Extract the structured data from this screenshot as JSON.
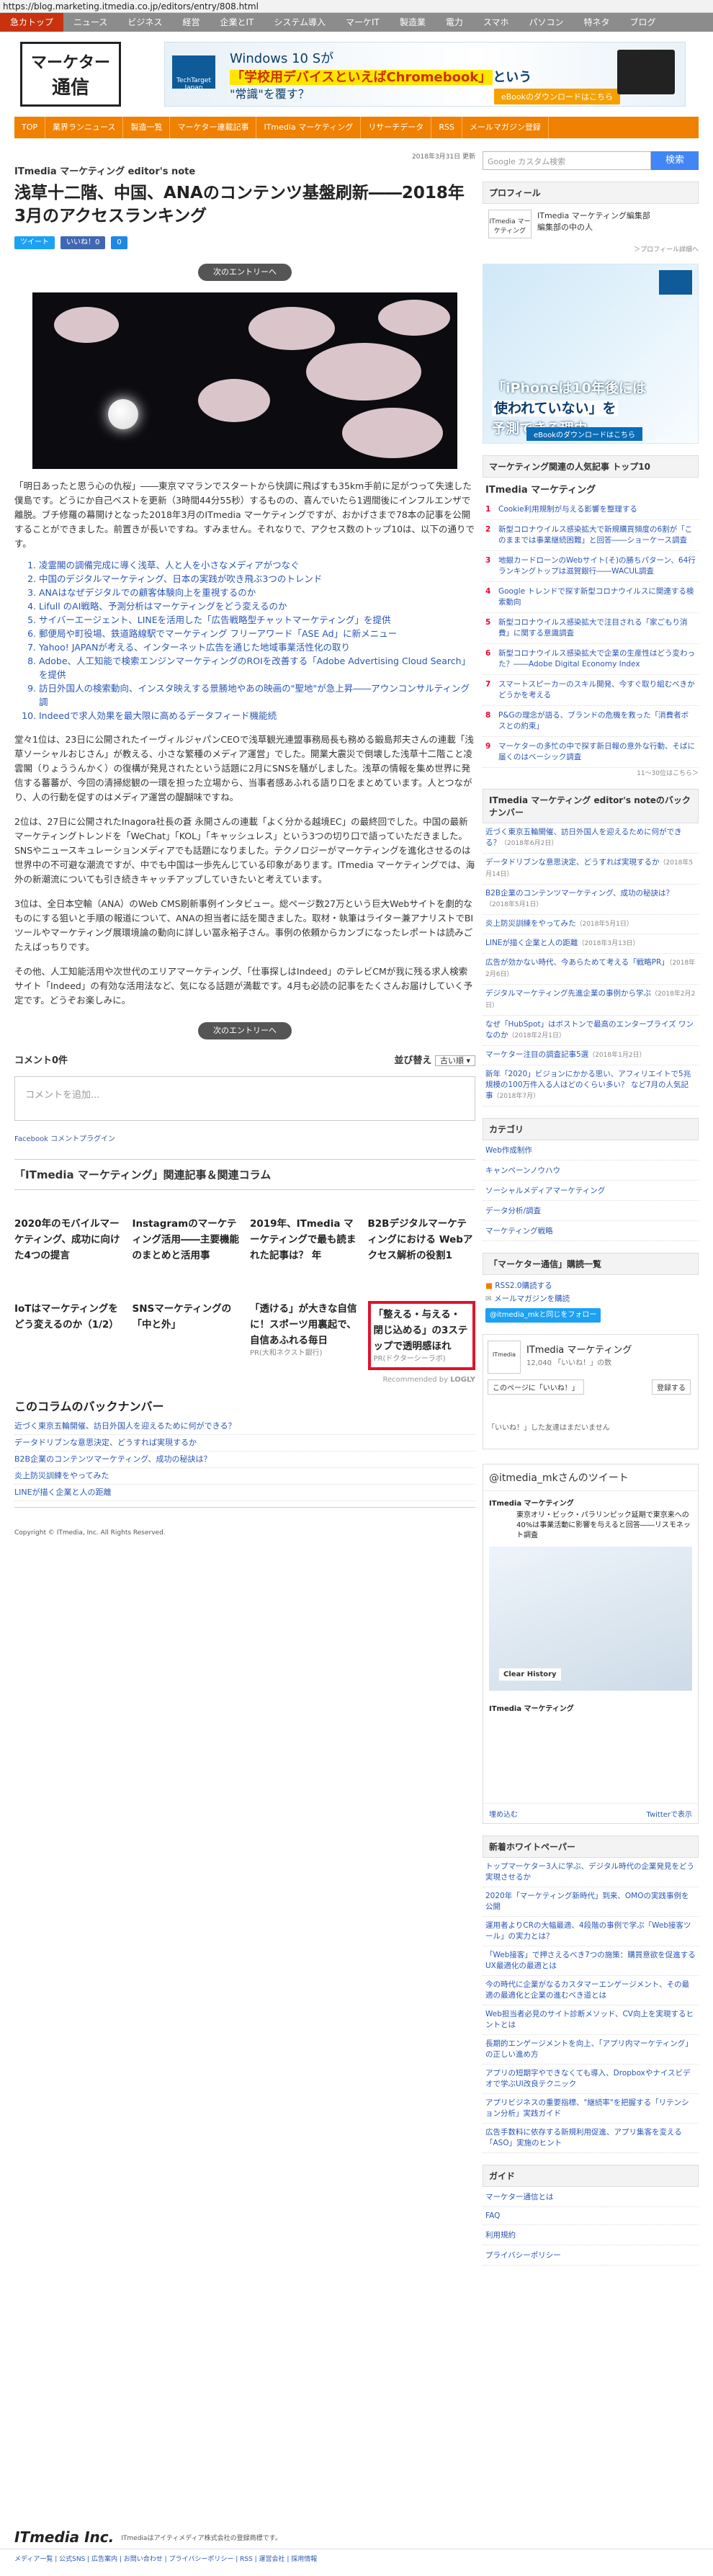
{
  "url": "https://blog.marketing.itmedia.co.jp/editors/entry/808.html",
  "gnav": [
    "急カトップ",
    "ニュース",
    "ビジネス",
    "経営",
    "企業とIT",
    "システム導入",
    "マーケIT",
    "製造業",
    "電力",
    "スマホ",
    "パソコン",
    "特ネタ",
    "ブログ"
  ],
  "banner": {
    "badge": "TechTarget Japan",
    "line1": "Windows 10 Sが",
    "line2a": "「学校用デバイスといえばChromebook」",
    "line2b": "という",
    "line3": "\"常識\"を覆す？",
    "cta": "eBookのダウンロードはこちら"
  },
  "logo": {
    "l1": "マーケター",
    "l2": "通信"
  },
  "onav": [
    "TOP",
    "業界ランニュース",
    "製造一覧",
    "マーケター連載記事",
    "ITmedia マーケティング",
    "リサーチデータ",
    "RSS",
    "メールマガジン登録"
  ],
  "article": {
    "date": "2018年3月31日 更新",
    "blog": "ITmedia マーケティング editor's note",
    "title": "浅草十二階、中国、ANAのコンテンツ基盤刷新――2018年3月のアクセスランキング",
    "social": [
      "ツイート",
      "いいね！0",
      "0"
    ],
    "next": "次のエントリーへ",
    "p1": "「明日あったと思う心の仇桜」――東京ママランでスタートから快調に飛ばすも35km手前に足がつって失速した僕島です。どうにか自己ベストを更新（3時間44分55秒）するものの、喜んでいたら1週間後にインフルエンザで離脱。ブチ修羅の幕開けとなった2018年3月のITmedia マーケティングですが、おかげさまで78本の記事を公開することができました。前置きが長いですね。すみません。それなりで、アクセス数のトップ10は、以下の通りです。",
    "list": [
      "凌霊閣の調備完成に導く浅草、人と人を小さなメディアがつなぐ",
      "中国のデジタルマーケティング、日本の実践が吹き飛ぶ3つのトレンド",
      "ANAはなぜデジタルでの顧客体験向上を重視するのか",
      "Lifull のAI戦略、予測分析はマーケティングをどう変えるのか",
      "サイバーエージェント、LINEを活用した「広告戦略型チャットマーケティング」を提供",
      "郵便局や町役場、鉄道路線駅でマーケティング フリーアワード「ASE Ad」に新メニュー",
      "Yahoo! JAPANが考える、インターネット広告を通じた地域事業活性化の取り",
      "Adobe、人工知能で検索エンジンマーケティングのROIを改善する「Adobe Advertising Cloud Search」を提供",
      "訪日外国人の検索動向、インスタ映えする景勝地やあの映画の\"聖地\"が急上昇――アウンコンサルティング調",
      "Indeedで求人効果を最大限に高めるデータフィード機能続"
    ],
    "p2": "堂々1位は、23日に公開されたイーヴィルジャパンCEOで浅草観光連盟事務局長も務める鍛島邦夫さんの連載「浅草ソーシャルおじさん」が教える、小さな繁種のメディア運営」でした。開業大震災で倒壊した浅草十二階こと凌雲閣（りょううんかく）の復構が発見されたという話題に2月にSNSを騒がしました。浅草の情報を集め世界に発信する蕃蕃が、今回の清掃総観の一環を担った立場から、当事者感あふれる語り口をまとめています。人とつながり、人の行動を促すのはメディア運営の醍醐味ですね。",
    "p3": "2位は、27日に公開されたInagora社長の蒼 永開さんの連載「よく分かる越境EC」の最終回でした。中国の最新マーケティングトレンドを「WeChat」「KOL」「キャッシュレス」という3つの切り口で語っていただきました。SNSやニュースキュレーションメディアでも話題になりました。テクノロジーがマーケティングを進化させるのは世界中の不可避な潮流ですが、中でも中国は一歩先んじている印象があります。ITmedia マーケティングでは、海外の新潮流についても引き続きキャッチアップしていきたいと考えています。",
    "p4": "3位は、全日本空輸（ANA）のWeb CMS刷新事例インタビュー。総ページ数27万という巨大Webサイトを劇的なものにする狙いと手順の報道について、ANAの担当者に話を聞きました。取材・執筆はライター兼アナリストでBIツールやマーケティング展環境論の動向に詳しい冨永裕子さん。事例の依頼からカンブになったレポートは読みごたえばっちりです。",
    "p5": "その他、人工知能活用や次世代のエリアマーケティング、「仕事探しはIndeed」のテレビCMが我に残る求人検索サイト「Indeed」の有効な活用法など、気になる話題が満載です。4月も必読の記事をたくさんお届けしていく予定です。どうぞお楽しみに。",
    "comments": {
      "count": "コメント0件",
      "sort": "並び替え",
      "sort_val": "古い順 ▾",
      "placeholder": "コメントを追加...",
      "fb": "Facebook コメントプラグイン"
    },
    "related_title": "「ITmedia マーケティング」関連記事＆関連コラム",
    "cards": [
      {
        "t": "2020年のモバイルマーケティング、成功に向けた4つの提言",
        "s": ""
      },
      {
        "t": "Instagramのマーケティング活用――主要機能のまとめと活用事",
        "s": ""
      },
      {
        "t": "2019年、ITmedia マーケティングで最も読まれた記事は？ 年",
        "s": ""
      },
      {
        "t": "B2Bデジタルマーケティングにおける Webアクセス解析の役割1",
        "s": ""
      },
      {
        "t": "IoTはマーケティングをどう変えるのか（1/2）",
        "s": ""
      },
      {
        "t": "SNSマーケティングの「中と外」",
        "s": ""
      },
      {
        "t": "「透ける」が大きな自信に！スポーツ用裏起で、自信あふれる毎日",
        "s": "PR(大和ネクスト銀行)"
      },
      {
        "t": "「整える・与える・閉じ込める」の3ステップで透明感ほれ",
        "s": "PR(ドクターシーラボ)"
      }
    ],
    "recommended": "Recommended by",
    "logly": "LOGLY",
    "back_title": "このコラムのバックナンバー",
    "back": [
      "近づく東京五輪開催、訪日外国人を迎えるために何ができる？",
      "データドリブンな意思決定、どうすれば実現するか",
      "B2B企業のコンテンツマーケティング、成功の秘訣は？",
      "炎上防災訓練をやってみた",
      "LINEが描く企業と人の距離"
    ],
    "copyright": "Copyright © ITmedia, Inc. All Rights Reserved."
  },
  "side": {
    "search_placeholder": "Google カスタム検索",
    "search_btn": "検索",
    "profile_title": "プロフィール",
    "profile_name": "ITmedia マーケティング編集部",
    "profile_sub": "編集部の中の人",
    "profile_icon": "ITmedia マーケティング",
    "profile_more": "＞プロフィール詳細へ",
    "ad_line1": "「iPhoneは10年後には",
    "ad_line2": "使われていない」を",
    "ad_line3": "予測できる理由",
    "ad_cta": "eBookのダウンロードはこちら",
    "rank_title": "マーケティング関連の人気記事 トップ10",
    "rank_logo": "ITmedia マーケティング",
    "rank": [
      "Cookie利用規制が与える影響を整理する",
      "新型コロナウイルス感染拡大で新規購買頻度の6割が「このままでは事業継続困難」と回答――ショーケース調査",
      "地銀カードローンのWebサイト(そ)の勝ちパターン、64行ランキングトップは滋賀銀行――WACUL調査",
      "Google トレンドで探す新型コロナウイルスに関連する検索動向",
      "新型コロナウイルス感染拡大で注目される「家ごもり消費」に関する意識調査",
      "新型コロナウイルス感染拡大で企業の生産性はどう変わった？――Adobe Digital Economy Index",
      "スマートスピーカーのスキル開発、今すぐ取り組むべきかどうかを考える",
      "P&Gの理念が語る、ブランドの危機を救った「消費者ボスとの約束」",
      "マーケターの多忙の中で探す新日報の意外な行動、そばに届くのはベーシック調査"
    ],
    "rank_more": "11～30位はこちら＞",
    "bn_title": "ITmedia マーケティング editor's noteのバックナンバー",
    "bn": [
      {
        "t": "近づく東京五輪開催、訪日外国人を迎えるために何ができる？",
        "d": "（2018年6月2日）"
      },
      {
        "t": "データドリブンな意思決定、どうすれば実現するか",
        "d": "（2018年5月14日）"
      },
      {
        "t": "B2B企業のコンテンツマーケティング、成功の秘訣は？",
        "d": "（2018年5月1日）"
      },
      {
        "t": "炎上防災訓練をやってみた",
        "d": "（2018年5月1日）"
      },
      {
        "t": "LINEが描く企業と人の距離",
        "d": "（2018年3月13日）"
      },
      {
        "t": "広告が効かない時代、今あらためて考える「戦略PR」",
        "d": "（2018年2月6日）"
      },
      {
        "t": "デジタルマーケティング先進企業の事例から学ぶ",
        "d": "（2018年2月2日）"
      },
      {
        "t": "なぜ「HubSpot」はボストンで最高のエンタープライズ ワンなのか",
        "d": "（2018年2月1日）"
      },
      {
        "t": "マーケター注目の調査記事5選",
        "d": "（2018年1月2日）"
      },
      {
        "t": "新年「2020」ビジョンにかかる思い、アフィリエイトで5兆規模の100万件入る人はどのくらい多い？ など7月の人気記事",
        "d": "（2018年7月）"
      }
    ],
    "cat_title": "カテゴリ",
    "cats": [
      "Web作成制作",
      "キャンペーンノウハウ",
      "ソーシャルメディアマーケティング",
      "データ分析/調査",
      "マーケティング戦略"
    ],
    "sub_title": "「マーケター通信」購読一覧",
    "sub_rss": "RSS2.0購読する",
    "sub_mail": "メールマガジンを購読",
    "tw_btn": "@itmedia_mkと同じをフォロー",
    "fb_name": "ITmedia マーケティング",
    "fb_count": "12,040 「いいね！」の数",
    "fb_like": "このページに「いいね！」",
    "fb_share": "登録する",
    "fb_none": "「いいね！」した友達はまだいません",
    "twh": "@itmedia_mkさんのツイート",
    "tw_name": "ITmedia マーケティング",
    "tw_text": "東京オリ・ビック・パラリンピック延期で東京来への40%は事業活動に影響を与えると回答――リスモネット調査",
    "tw_img": "Clear History",
    "tw_embed": "埋め込む",
    "tw_view": "Twitterで表示",
    "wp_title": "新着ホワイトペーパー",
    "wp": [
      "トップマーケター3人に学ぶ、デジタル時代の企業発見をどう実現させるか",
      "2020年「マーケティング新時代」到来、OMOの実践事例を公開",
      "運用者よりCRの大幅最適、4段階の事例で学ぶ「Web接客ツール」の実力とは？",
      "「Web接客」で押さえるべき7つの施策：購買意欲を促進するUX最適化の最適とは",
      "今の時代に企業がなるカスタマーエンゲージメント、その最適の最適化と企業の進むべき道とは",
      "Web担当者必見のサイト診断メソッド、CV向上を実現するヒントとは",
      "長期的エンゲージメントを向上、「アプリ内マーケティング」の正しい進め方",
      "アプリの短期字やできなくても導入、Dropboxやナイスビデオで学ぶUI改良テクニック",
      "アプリビジネスの重要指標、\"継続率\"を把握する「リテンション分析」実践ガイド",
      "広告手数料に依存する新規利用促進、アプリ集客を変える「ASO」実施のヒント"
    ],
    "guide_title": "ガイド",
    "guide": [
      "マーケター通信とは",
      "FAQ",
      "利用規約",
      "プライバシーポリシー"
    ]
  },
  "footer": {
    "logo": "ITmedia Inc.",
    "tag": "ITmediaはアイティメディア株式会社の登録商標です。",
    "links": "メディア一覧 | 公式SNS | 広告案内 | お問い合わせ | プライバシーポリシー | RSS | 運営会社 | 採用情報"
  }
}
